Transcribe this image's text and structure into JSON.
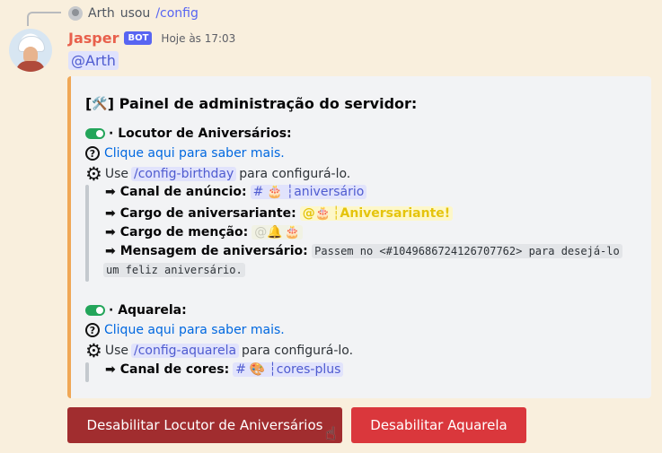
{
  "reply": {
    "user": "Arth",
    "verb": "usou",
    "command": "/config"
  },
  "message": {
    "author": "Jasper",
    "bot_tag": "BOT",
    "timestamp": "Hoje às 17:03",
    "mention": "@Arth"
  },
  "embed": {
    "accent_color": "#f0a755",
    "title_icon": "🛠️",
    "title": "Painel de administração do servidor:",
    "birthday": {
      "name": "Locutor de Aniversários:",
      "help_link": "Clique aqui para saber mais.",
      "use_prefix": "Use",
      "command": "/config-birthday",
      "use_suffix": "para configurá-lo.",
      "fields": {
        "announce_label": "Canal de anúncio:",
        "announce_channel_prefix": "#",
        "announce_channel_emoji": "🎂",
        "announce_channel": "┆aniversário",
        "role_label": "Cargo de aniversariante:",
        "role_prefix": "@🎂",
        "role_name": "┆Aniversariante!",
        "mention_label": "Cargo de menção:",
        "mention_role_prefix": "@🔔",
        "mention_role_emoji": "🎂",
        "message_label": "Mensagem de aniversário:",
        "message_value_1": "Passem no <#1049686724126707762> para desejá-lo",
        "message_value_2": "um feliz aniversário."
      }
    },
    "watercolor": {
      "name": "Aquarela:",
      "help_link": "Clique aqui para saber mais.",
      "use_prefix": "Use",
      "command": "/config-aquarela",
      "use_suffix": "para configurá-lo.",
      "fields": {
        "colors_label": "Canal de cores:",
        "colors_channel_prefix": "#",
        "colors_channel_emoji": "🎨",
        "colors_channel": "┆cores-plus"
      }
    }
  },
  "buttons": {
    "disable_birthday": "Desabilitar Locutor de Aniversários",
    "disable_watercolor": "Desabilitar Aquarela"
  },
  "colors": {
    "background": "#f9efdd",
    "username": "#e8604c",
    "bot_tag": "#5865f2",
    "link": "#0068e0",
    "toggle_on": "#23a55a",
    "button_dark": "#a12d2f",
    "button_red": "#da373c",
    "role_yellow": "#e5c40c"
  },
  "icons": {
    "toggle": "toggle-on-icon",
    "help": "question-circle-icon",
    "settings": "gear-icon",
    "arrow": "arrow-right-icon",
    "cursor": "hand-pointer-icon"
  }
}
